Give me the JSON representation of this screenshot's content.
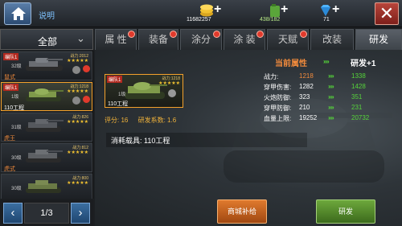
{
  "topbar": {
    "help_label": "说明",
    "resources": [
      {
        "name": "gold-coins",
        "icon": "coins-icon",
        "value": "11682257"
      },
      {
        "name": "fuel",
        "icon": "fuel-can-icon",
        "value": "438/182"
      },
      {
        "name": "diamonds",
        "icon": "diamond-icon",
        "value": "71"
      }
    ],
    "plus_label": "+",
    "close_label": "✕"
  },
  "filter": {
    "selected": "全部",
    "chevron": "⌄"
  },
  "tabs": [
    {
      "label": "属 性",
      "has_alert": true,
      "active": false
    },
    {
      "label": "装备",
      "has_alert": true,
      "active": false
    },
    {
      "label": "涂分",
      "has_alert": true,
      "active": false
    },
    {
      "label": "涂 装",
      "has_alert": true,
      "active": false
    },
    {
      "label": "天赋",
      "has_alert": true,
      "active": false
    },
    {
      "label": "改装",
      "has_alert": false,
      "active": false
    },
    {
      "label": "研发",
      "has_alert": false,
      "active": true
    }
  ],
  "tank_list": [
    {
      "badge": "编队1",
      "power": "战力:2012",
      "stars": "★★★★★",
      "level": "32级",
      "name": "鼠式"
    },
    {
      "badge": "编队1",
      "power": "战力:1218",
      "stars": "★★★★★",
      "level": "1级",
      "name": "110工程"
    },
    {
      "badge": "",
      "power": "战力:826",
      "stars": "★★★★★",
      "level": "31级",
      "name": "虎王"
    },
    {
      "badge": "",
      "power": "战力:812",
      "stars": "★★★★★",
      "level": "30级",
      "name": "虎式"
    },
    {
      "badge": "",
      "power": "战力:800",
      "stars": "★★★★★",
      "level": "30级",
      "name": ""
    }
  ],
  "pager": {
    "prev": "‹",
    "next": "›",
    "page": "1/3"
  },
  "selected_tank": {
    "badge": "编队1",
    "power": "战力:1218",
    "stars": "★★★★★",
    "level": "1级",
    "name": "110工程",
    "score_label": "评分: 16",
    "dev_factor_label": "研发系数: 1.6"
  },
  "consume": "消耗载具: 110工程",
  "stats": {
    "current_header": "当前属性",
    "dev_header": "研发+1",
    "arrows": "››››",
    "rows": [
      {
        "key": "战力:",
        "current": "1218",
        "next": "1338",
        "current_color": "#f08a3c"
      },
      {
        "key": "穿甲伤害:",
        "current": "1282",
        "next": "1428",
        "current_color": "#ffffff"
      },
      {
        "key": "火炮防御:",
        "current": "323",
        "next": "351",
        "current_color": "#ffffff"
      },
      {
        "key": "穿甲防御:",
        "current": "210",
        "next": "231",
        "current_color": "#ffffff"
      },
      {
        "key": "血量上限:",
        "current": "19252",
        "next": "20732",
        "current_color": "#ffffff"
      }
    ]
  },
  "buttons": {
    "shop_supply": "商城补给",
    "research": "研发"
  }
}
